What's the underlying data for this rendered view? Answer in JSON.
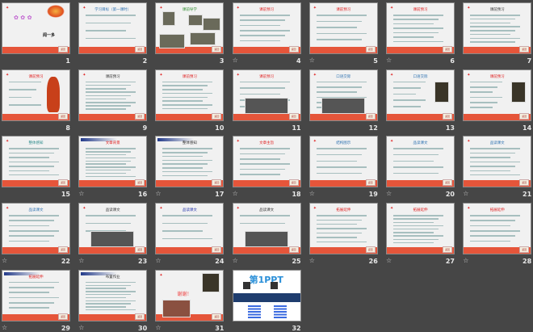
{
  "app": {
    "view": "slide-sorter"
  },
  "return_label": "返回",
  "colors": {
    "background": "#464646",
    "footer": "#e5553a",
    "title": "#e02020"
  },
  "slides": [
    {
      "number": "1",
      "title": "",
      "special": "cover",
      "star": false,
      "cover_author": "闻一多"
    },
    {
      "number": "2",
      "title": "学习目标（第一课时）",
      "star": false,
      "lines": 4,
      "title_color": "#2a6fb0"
    },
    {
      "number": "3",
      "title": "课前导学",
      "star": false,
      "images": true,
      "title_color": "#2a8a2a"
    },
    {
      "number": "4",
      "title": "课前预习",
      "star": true,
      "lines": 6
    },
    {
      "number": "5",
      "title": "课前预习",
      "star": true,
      "lines": 5
    },
    {
      "number": "6",
      "title": "课前预习",
      "star": true,
      "lines": 7
    },
    {
      "number": "7",
      "title": "课前预习",
      "star": false,
      "lines": 8,
      "title_color": "#333333"
    },
    {
      "number": "8",
      "title": "课前预习",
      "star": false,
      "vase": true,
      "lines": 4
    },
    {
      "number": "9",
      "title": "课前预习",
      "star": false,
      "lines": 9,
      "title_color": "#333333"
    },
    {
      "number": "10",
      "title": "课前预习",
      "star": false,
      "lines": 8
    },
    {
      "number": "11",
      "title": "课前预习",
      "star": false,
      "lines": 5,
      "photo": true
    },
    {
      "number": "12",
      "title": "口语交际",
      "star": false,
      "lines": 6,
      "photo": true,
      "title_color": "#2a6fb0"
    },
    {
      "number": "13",
      "title": "口语交际",
      "star": false,
      "lines": 5,
      "portrait": true,
      "title_color": "#2a6fb0"
    },
    {
      "number": "14",
      "title": "课前预习",
      "star": false,
      "lines": 6,
      "portrait": true
    },
    {
      "number": "15",
      "title": "整体感知",
      "star": false,
      "lines": 7,
      "title_color": "#2a8a8a"
    },
    {
      "number": "16",
      "title": "文章背景",
      "star": true,
      "lines": 10,
      "grad": true
    },
    {
      "number": "17",
      "title": "整体感知",
      "star": true,
      "lines": 8,
      "grad": true,
      "title_color": "#333333"
    },
    {
      "number": "18",
      "title": "文章主旨",
      "star": true,
      "lines": 6
    },
    {
      "number": "19",
      "title": "结构图示",
      "star": true,
      "lines": 5,
      "title_color": "#2a6fb0"
    },
    {
      "number": "20",
      "title": "品读课文",
      "star": true,
      "lines": 5,
      "title_color": "#2a6fb0"
    },
    {
      "number": "21",
      "title": "品读课文",
      "star": true,
      "lines": 7,
      "title_color": "#2a6fb0"
    },
    {
      "number": "22",
      "title": "品读课文",
      "star": true,
      "lines": 6,
      "title_color": "#2a6fb0"
    },
    {
      "number": "23",
      "title": "品读课文",
      "star": true,
      "lines": 3,
      "photo": true,
      "title_color": "#333333"
    },
    {
      "number": "24",
      "title": "品读课文",
      "star": true,
      "lines": 4,
      "title_color": "#2233aa"
    },
    {
      "number": "25",
      "title": "品读课文",
      "star": true,
      "lines": 2,
      "photo": true,
      "title_color": "#333333"
    },
    {
      "number": "26",
      "title": "拓展延伸",
      "star": true,
      "lines": 7
    },
    {
      "number": "27",
      "title": "拓展延伸",
      "star": true,
      "lines": 9
    },
    {
      "number": "28",
      "title": "拓展延伸",
      "star": true,
      "lines": 6
    },
    {
      "number": "29",
      "title": "拓展延伸",
      "star": true,
      "lines": 6,
      "grad": true
    },
    {
      "number": "30",
      "title": "布置作业",
      "star": true,
      "lines": 10,
      "grad": true,
      "title_color": "#333333"
    },
    {
      "number": "31",
      "title": "谢谢！",
      "star": true,
      "special": "thanks"
    },
    {
      "number": "32",
      "title": "第1PPT",
      "star": false,
      "special": "brand"
    }
  ]
}
